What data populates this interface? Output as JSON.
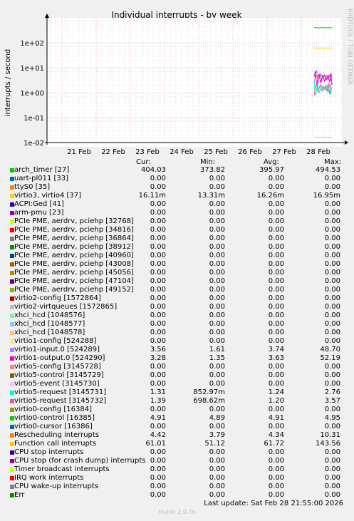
{
  "chart_data": {
    "type": "line",
    "title": "Individual interrupts - by week",
    "ylabel": "interrupts / second",
    "yscale": "log",
    "ylim": [
      0.01,
      1000
    ],
    "y_ticks": [
      "1e-02",
      "1e-01",
      "1e+00",
      "1e+01",
      "1e+02"
    ],
    "x_ticks": [
      "21 Feb",
      "22 Feb",
      "23 Feb",
      "24 Feb",
      "25 Feb",
      "26 Feb",
      "27 Feb",
      "28 Feb"
    ],
    "grid": true,
    "columns": [
      "Cur:",
      "Min:",
      "Avg:",
      "Max:"
    ],
    "series": [
      {
        "name": "arch_timer [27]",
        "color": "#00cc00",
        "values": [
          "404.03",
          "373.82",
          "395.97",
          "494.53"
        ]
      },
      {
        "name": "uart-pl011 [33]",
        "color": "#0066b3",
        "values": [
          "0.00",
          "0.00",
          "0.00",
          "0.00"
        ]
      },
      {
        "name": "ttyS0 [35]",
        "color": "#ff8000",
        "values": [
          "0.00",
          "0.00",
          "0.00",
          "0.00"
        ]
      },
      {
        "name": "virtio3, virtio4 [37]",
        "color": "#ffcc00",
        "values": [
          "16.11m",
          "13.31m",
          "16.26m",
          "16.95m"
        ]
      },
      {
        "name": "ACPI:Ged [41]",
        "color": "#330099",
        "values": [
          "0.00",
          "0.00",
          "0.00",
          "0.00"
        ]
      },
      {
        "name": "arm-pmu [23]",
        "color": "#990099",
        "values": [
          "0.00",
          "0.00",
          "0.00",
          "0.00"
        ]
      },
      {
        "name": "PCIe PME, aerdrv, pciehp [32768]",
        "color": "#ccff00",
        "values": [
          "0.00",
          "0.00",
          "0.00",
          "0.00"
        ]
      },
      {
        "name": "PCIe PME, aerdrv, pciehp [34816]",
        "color": "#ff0000",
        "values": [
          "0.00",
          "0.00",
          "0.00",
          "0.00"
        ]
      },
      {
        "name": "PCIe PME, aerdrv, pciehp [36864]",
        "color": "#808080",
        "values": [
          "0.00",
          "0.00",
          "0.00",
          "0.00"
        ]
      },
      {
        "name": "PCIe PME, aerdrv, pciehp [38912]",
        "color": "#008f00",
        "values": [
          "0.00",
          "0.00",
          "0.00",
          "0.00"
        ]
      },
      {
        "name": "PCIe PME, aerdrv, pciehp [40960]",
        "color": "#00487d",
        "values": [
          "0.00",
          "0.00",
          "0.00",
          "0.00"
        ]
      },
      {
        "name": "PCIe PME, aerdrv, pciehp [43008]",
        "color": "#b35a00",
        "values": [
          "0.00",
          "0.00",
          "0.00",
          "0.00"
        ]
      },
      {
        "name": "PCIe PME, aerdrv, pciehp [45056]",
        "color": "#b38f00",
        "values": [
          "0.00",
          "0.00",
          "0.00",
          "0.00"
        ]
      },
      {
        "name": "PCIe PME, aerdrv, pciehp [47104]",
        "color": "#6b006b",
        "values": [
          "0.00",
          "0.00",
          "0.00",
          "0.00"
        ]
      },
      {
        "name": "PCIe PME, aerdrv, pciehp [49152]",
        "color": "#8fb300",
        "values": [
          "0.00",
          "0.00",
          "0.00",
          "0.00"
        ]
      },
      {
        "name": "virtio2-config [1572864]",
        "color": "#b30000",
        "values": [
          "0.00",
          "0.00",
          "0.00",
          "0.00"
        ]
      },
      {
        "name": "virtio2-virtqueues [1572865]",
        "color": "#bebebe",
        "values": [
          "0.00",
          "0.00",
          "0.00",
          "0.00"
        ]
      },
      {
        "name": "xhci_hcd [1048576]",
        "color": "#80ff80",
        "values": [
          "0.00",
          "0.00",
          "0.00",
          "0.00"
        ]
      },
      {
        "name": "xhci_hcd [1048577]",
        "color": "#80c9ff",
        "values": [
          "0.00",
          "0.00",
          "0.00",
          "0.00"
        ]
      },
      {
        "name": "xhci_hcd [1048578]",
        "color": "#ffc080",
        "values": [
          "0.00",
          "0.00",
          "0.00",
          "0.00"
        ]
      },
      {
        "name": "virtio1-config [524288]",
        "color": "#ffe680",
        "values": [
          "0.00",
          "0.00",
          "0.00",
          "0.00"
        ]
      },
      {
        "name": "virtio1-input.0 [524289]",
        "color": "#aa80ff",
        "values": [
          "3.56",
          "1.61",
          "3.74",
          "48.70"
        ]
      },
      {
        "name": "virtio1-output.0 [524290]",
        "color": "#ee00cc",
        "values": [
          "3.28",
          "1.35",
          "3.63",
          "52.19"
        ]
      },
      {
        "name": "virtio5-config [3145728]",
        "color": "#ff8080",
        "values": [
          "0.00",
          "0.00",
          "0.00",
          "0.00"
        ]
      },
      {
        "name": "virtio5-control [3145729]",
        "color": "#666600",
        "values": [
          "0.00",
          "0.00",
          "0.00",
          "0.00"
        ]
      },
      {
        "name": "virtio5-event [3145730]",
        "color": "#ffbfff",
        "values": [
          "0.00",
          "0.00",
          "0.00",
          "0.00"
        ]
      },
      {
        "name": "virtio5-request [3145731]",
        "color": "#00ffcc",
        "values": [
          "1.31",
          "852.97m",
          "1.24",
          "2.76"
        ]
      },
      {
        "name": "virtio5-request [3145732]",
        "color": "#cc6699",
        "values": [
          "1.39",
          "698.62m",
          "1.20",
          "3.57"
        ]
      },
      {
        "name": "virtio0-config [16384]",
        "color": "#999900",
        "values": [
          "0.00",
          "0.00",
          "0.00",
          "0.00"
        ]
      },
      {
        "name": "virtio0-control [16385]",
        "color": "#00cc00",
        "values": [
          "4.91",
          "4.89",
          "4.91",
          "4.95"
        ]
      },
      {
        "name": "virtio0-cursor [16386]",
        "color": "#0066b3",
        "values": [
          "0.00",
          "0.00",
          "0.00",
          "0.00"
        ]
      },
      {
        "name": "Rescheduling interrupts",
        "color": "#ff8000",
        "values": [
          "4.42",
          "3.79",
          "4.34",
          "10.31"
        ]
      },
      {
        "name": "Function call interrupts",
        "color": "#ffcc00",
        "values": [
          "61.01",
          "51.12",
          "61.72",
          "143.56"
        ]
      },
      {
        "name": "CPU stop interrupts",
        "color": "#330099",
        "values": [
          "0.00",
          "0.00",
          "0.00",
          "0.00"
        ]
      },
      {
        "name": "CPU stop (for crash dump) interrupts",
        "color": "#990099",
        "values": [
          "0.00",
          "0.00",
          "0.00",
          "0.00"
        ]
      },
      {
        "name": "Timer broadcast interrupts",
        "color": "#ccff00",
        "values": [
          "0.00",
          "0.00",
          "0.00",
          "0.00"
        ]
      },
      {
        "name": "IRQ work interrupts",
        "color": "#ff0000",
        "values": [
          "0.00",
          "0.00",
          "0.00",
          "0.00"
        ]
      },
      {
        "name": "CPU wake-up interrupts",
        "color": "#808080",
        "values": [
          "0.00",
          "0.00",
          "0.00",
          "0.00"
        ]
      },
      {
        "name": "Err",
        "color": "#008f00",
        "values": [
          "0.00",
          "0.00",
          "0.00",
          "0.00"
        ]
      }
    ],
    "plotted_lines": [
      {
        "series": "arch_timer [27]",
        "level": 400
      },
      {
        "series": "Function call interrupts",
        "level": 61
      },
      {
        "series": "virtio0-control [16385]",
        "level": 4.91
      },
      {
        "series": "Rescheduling interrupts",
        "level": 4.4
      },
      {
        "series": "virtio1-input.0 [524289]",
        "level": 3.6
      },
      {
        "series": "virtio1-output.0 [524290]",
        "level": 3.3
      },
      {
        "series": "virtio5-request [3145731]",
        "level": 1.3
      },
      {
        "series": "virtio5-request [3145732]",
        "level": 1.4
      },
      {
        "series": "virtio3, virtio4 [37]",
        "level": 0.0161
      }
    ]
  },
  "footer": {
    "last_update": "Last update: Sat Feb 28 21:55:00 2026",
    "generator": "Munin 2.0.76",
    "side_text": "RRDTOOL / TOBI OETIKER"
  }
}
